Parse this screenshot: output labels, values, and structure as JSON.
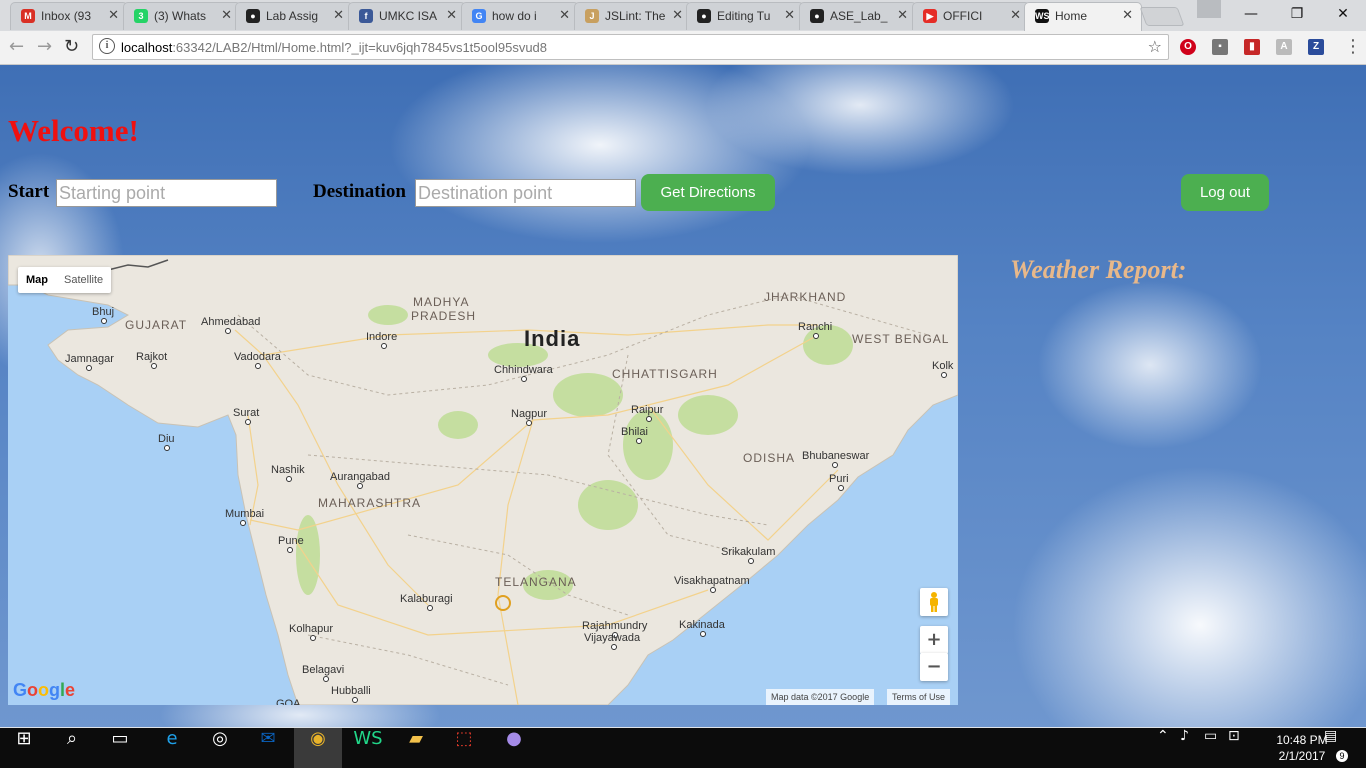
{
  "browser": {
    "tabs": [
      {
        "title": "Inbox (93",
        "icon": "gmail-icon",
        "color": "#d93025",
        "glyph": "M"
      },
      {
        "title": "(3) Whats",
        "icon": "whatsapp-icon",
        "color": "#25d366",
        "glyph": "3"
      },
      {
        "title": "Lab Assig",
        "icon": "github-icon",
        "color": "#222222",
        "glyph": "●"
      },
      {
        "title": "UMKC ISA",
        "icon": "facebook-icon",
        "color": "#3b5998",
        "glyph": "f"
      },
      {
        "title": "how do i",
        "icon": "google-icon",
        "color": "#4285f4",
        "glyph": "G"
      },
      {
        "title": "JSLint: The",
        "icon": "jslint-icon",
        "color": "#c8a060",
        "glyph": "J"
      },
      {
        "title": "Editing Tu",
        "icon": "github-icon",
        "color": "#222222",
        "glyph": "●"
      },
      {
        "title": "ASE_Lab_",
        "icon": "github-icon",
        "color": "#222222",
        "glyph": "●"
      },
      {
        "title": "OFFICI",
        "icon": "youtube-icon",
        "color": "#e52d27",
        "glyph": "▶"
      },
      {
        "title": "Home",
        "icon": "webstorm-icon",
        "color": "#111111",
        "glyph": "WS"
      }
    ],
    "active_tab": 9,
    "url_host": "localhost",
    "url_rest": ":63342/LAB2/Html/Home.html?_ijt=kuv6jqh7845vs1t5ool95svud8"
  },
  "page": {
    "welcome": "Welcome!",
    "start_label": "Start",
    "start_placeholder": "Starting point",
    "destination_label": "Destination",
    "destination_placeholder": "Destination point",
    "directions_button": "Get Directions",
    "logout_button": "Log out",
    "weather_heading": "Weather Report:",
    "button_color": "#4caf50",
    "welcome_color": "#f01010",
    "weather_color": "#e8b88a"
  },
  "map": {
    "type_map": "Map",
    "type_satellite": "Satellite",
    "zoom_in": "+",
    "zoom_out": "−",
    "attribution": "Map data ©2017 Google",
    "terms": "Terms of Use",
    "logo": "Google",
    "country": "India",
    "states": [
      "GUJARAT",
      "MADHYA PRADESH",
      "JHARKHAND",
      "WEST BENGAL",
      "CHHATTISGARH",
      "MAHARASHTRA",
      "ODISHA",
      "TELANGANA"
    ],
    "cities": [
      "Bhuj",
      "Ahmedabad",
      "Indore",
      "Ranchi",
      "Jamnagar",
      "Rajkot",
      "Vadodara",
      "Chhindwara",
      "Kolk",
      "Surat",
      "Nagpur",
      "Raipur",
      "Bhilai",
      "Diu",
      "Nashik",
      "Aurangabad",
      "Bhubaneswar",
      "Puri",
      "Mumbai",
      "Pune",
      "Srikakulam",
      "Visakhapatnam",
      "Kalaburagi",
      "Kolhapur",
      "Rajahmundry",
      "Kakinada",
      "Vijayawada",
      "Belagavi",
      "Hubballi",
      "GOA"
    ]
  },
  "taskbar": {
    "time": "10:48 PM",
    "date": "2/1/2017",
    "notifications": "9"
  }
}
